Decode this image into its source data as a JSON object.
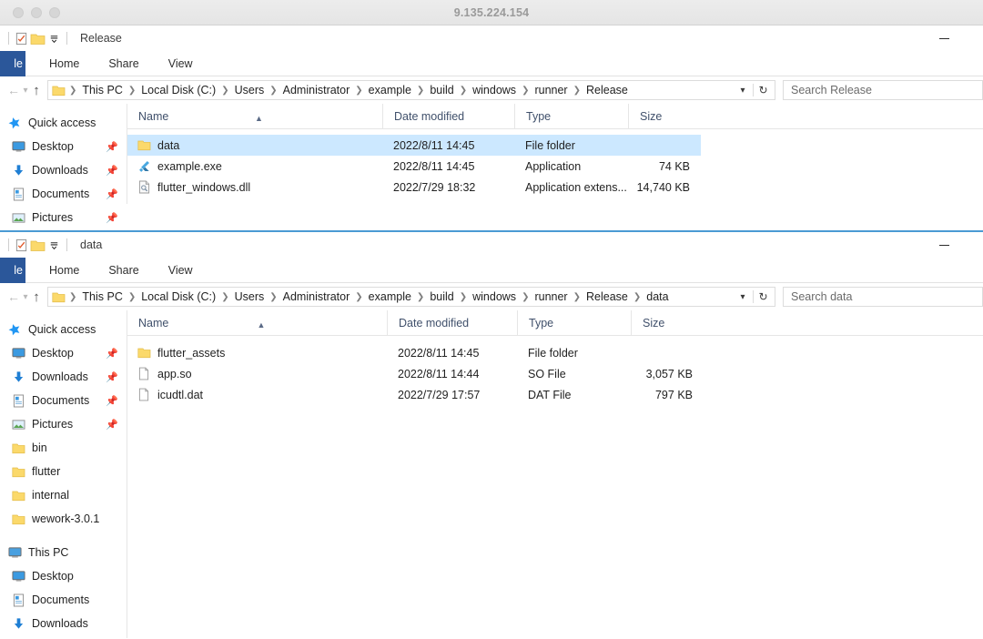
{
  "mac_window": {
    "title": "9.135.224.154",
    "traffic_lights": [
      "close-button",
      "minimize-button",
      "zoom-button"
    ]
  },
  "colors": {
    "accent_blue": "#2b579a",
    "selection_blue": "#cce8ff",
    "active_border": "#4a9ad4",
    "folder_yellow": "#f8d775",
    "column_header_text": "#40506b"
  },
  "windows": [
    {
      "id": "release-window",
      "title": "Release",
      "minimize_label": "—",
      "quick_access": [
        "properties-icon",
        "new-folder-icon",
        "customize-dropdown-icon"
      ],
      "ribbon": {
        "file_tab": "le",
        "file_tab_full": "File",
        "tabs": [
          "Home",
          "Share",
          "View"
        ]
      },
      "address": {
        "back_icon": "arrow-left-icon",
        "forward_icon": "arrow-right-icon",
        "recent_icon": "chevron-down-icon",
        "up_icon": "arrow-up-icon",
        "breadcrumbs": [
          "This PC",
          "Local Disk (C:)",
          "Users",
          "Administrator",
          "example",
          "build",
          "windows",
          "runner",
          "Release"
        ],
        "dropdown_icon": "chevron-down-icon",
        "refresh_icon": "refresh-icon",
        "search_placeholder": "Search Release"
      },
      "sidebar": [
        {
          "label": "Quick access",
          "icon": "star-icon",
          "pinned": false,
          "indent": false
        },
        {
          "label": "Desktop",
          "icon": "desktop-icon",
          "pinned": true,
          "indent": true
        },
        {
          "label": "Downloads",
          "icon": "download-icon",
          "pinned": true,
          "indent": true
        },
        {
          "label": "Documents",
          "icon": "document-icon",
          "pinned": true,
          "indent": true
        },
        {
          "label": "Pictures",
          "icon": "pictures-icon",
          "pinned": true,
          "indent": true
        }
      ],
      "columns": [
        {
          "label": "Name",
          "sorted": true,
          "sort_dir": "asc"
        },
        {
          "label": "Date modified",
          "sorted": false
        },
        {
          "label": "Type",
          "sorted": false
        },
        {
          "label": "Size",
          "sorted": false
        }
      ],
      "files": [
        {
          "name": "data",
          "date": "2022/8/11 14:45",
          "type": "File folder",
          "size": "",
          "icon": "folder-icon",
          "selected": true
        },
        {
          "name": "example.exe",
          "date": "2022/8/11 14:45",
          "type": "Application",
          "size": "74 KB",
          "icon": "flutter-app-icon",
          "selected": false
        },
        {
          "name": "flutter_windows.dll",
          "date": "2022/7/29 18:32",
          "type": "Application extens...",
          "size": "14,740 KB",
          "icon": "dll-file-icon",
          "selected": false
        }
      ]
    },
    {
      "id": "data-window",
      "title": "data",
      "minimize_label": "—",
      "quick_access": [
        "properties-icon",
        "new-folder-icon",
        "customize-dropdown-icon"
      ],
      "ribbon": {
        "file_tab": "le",
        "file_tab_full": "File",
        "tabs": [
          "Home",
          "Share",
          "View"
        ]
      },
      "address": {
        "back_icon": "arrow-left-icon",
        "forward_icon": "arrow-right-icon",
        "recent_icon": "chevron-down-icon",
        "up_icon": "arrow-up-icon",
        "breadcrumbs": [
          "This PC",
          "Local Disk (C:)",
          "Users",
          "Administrator",
          "example",
          "build",
          "windows",
          "runner",
          "Release",
          "data"
        ],
        "dropdown_icon": "chevron-down-icon",
        "refresh_icon": "refresh-icon",
        "search_placeholder": "Search data"
      },
      "sidebar": [
        {
          "label": "Quick access",
          "icon": "star-icon",
          "pinned": false,
          "indent": false
        },
        {
          "label": "Desktop",
          "icon": "desktop-icon",
          "pinned": true,
          "indent": true
        },
        {
          "label": "Downloads",
          "icon": "download-icon",
          "pinned": true,
          "indent": true
        },
        {
          "label": "Documents",
          "icon": "document-icon",
          "pinned": true,
          "indent": true
        },
        {
          "label": "Pictures",
          "icon": "pictures-icon",
          "pinned": true,
          "indent": true
        },
        {
          "label": "bin",
          "icon": "folder-icon",
          "pinned": false,
          "indent": true
        },
        {
          "label": "flutter",
          "icon": "folder-icon",
          "pinned": false,
          "indent": true
        },
        {
          "label": "internal",
          "icon": "folder-icon",
          "pinned": false,
          "indent": true
        },
        {
          "label": "wework-3.0.1",
          "icon": "folder-icon",
          "pinned": false,
          "indent": true
        },
        {
          "label": "This PC",
          "icon": "pc-icon",
          "pinned": false,
          "indent": false
        },
        {
          "label": "Desktop",
          "icon": "desktop-icon",
          "pinned": false,
          "indent": true
        },
        {
          "label": "Documents",
          "icon": "document-icon",
          "pinned": false,
          "indent": true
        },
        {
          "label": "Downloads",
          "icon": "download-icon",
          "pinned": false,
          "indent": true
        }
      ],
      "columns": [
        {
          "label": "Name",
          "sorted": true,
          "sort_dir": "asc"
        },
        {
          "label": "Date modified",
          "sorted": false
        },
        {
          "label": "Type",
          "sorted": false
        },
        {
          "label": "Size",
          "sorted": false
        }
      ],
      "files": [
        {
          "name": "flutter_assets",
          "date": "2022/8/11 14:45",
          "type": "File folder",
          "size": "",
          "icon": "folder-icon",
          "selected": false
        },
        {
          "name": "app.so",
          "date": "2022/8/11 14:44",
          "type": "SO File",
          "size": "3,057 KB",
          "icon": "generic-file-icon",
          "selected": false
        },
        {
          "name": "icudtl.dat",
          "date": "2022/7/29 17:57",
          "type": "DAT File",
          "size": "797 KB",
          "icon": "generic-file-icon",
          "selected": false
        }
      ]
    }
  ]
}
